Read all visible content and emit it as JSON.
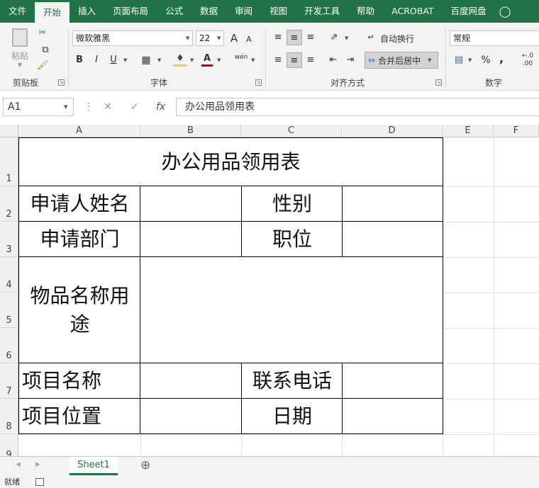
{
  "tabs": [
    "文件",
    "开始",
    "插入",
    "页面布局",
    "公式",
    "数据",
    "审阅",
    "视图",
    "开发工具",
    "帮助",
    "ACROBAT",
    "百度网盘"
  ],
  "ribbon": {
    "paste_label": "粘贴",
    "clipboard_label": "剪贴板",
    "font_name": "微软雅黑",
    "font_size": "22",
    "bold": "B",
    "italic": "I",
    "underline": "U",
    "font_grow": "A",
    "font_shrink": "A",
    "font_color_label": "A",
    "phonetic_label": "wén",
    "font_label": "字体",
    "wrap_text": "自动换行",
    "merge_center": "合并后居中",
    "align_label": "对齐方式",
    "number_format": "常规",
    "number_label": "数字",
    "percent": "%",
    "comma": ",",
    "decimal_inc": "←.0 .00"
  },
  "formula_bar": {
    "name_box": "A1",
    "cancel": "✕",
    "confirm": "✓",
    "fx": "fx",
    "content": "办公用品领用表"
  },
  "columns": [
    "A",
    "B",
    "C",
    "D",
    "E",
    "F"
  ],
  "rows": [
    "1",
    "2",
    "3",
    "4",
    "5",
    "6",
    "7",
    "8",
    "9"
  ],
  "cells": {
    "title": "办公用品领用表",
    "applicant_name": "申请人姓名",
    "gender": "性别",
    "department": "申请部门",
    "position": "职位",
    "item_purpose": "物品名称用途",
    "project_name": "项目名称",
    "contact_phone": "联系电话",
    "project_location": "项目位置",
    "date": "日期"
  },
  "sheet_tab": "Sheet1",
  "add_sheet": "⊕",
  "status": "就绪"
}
